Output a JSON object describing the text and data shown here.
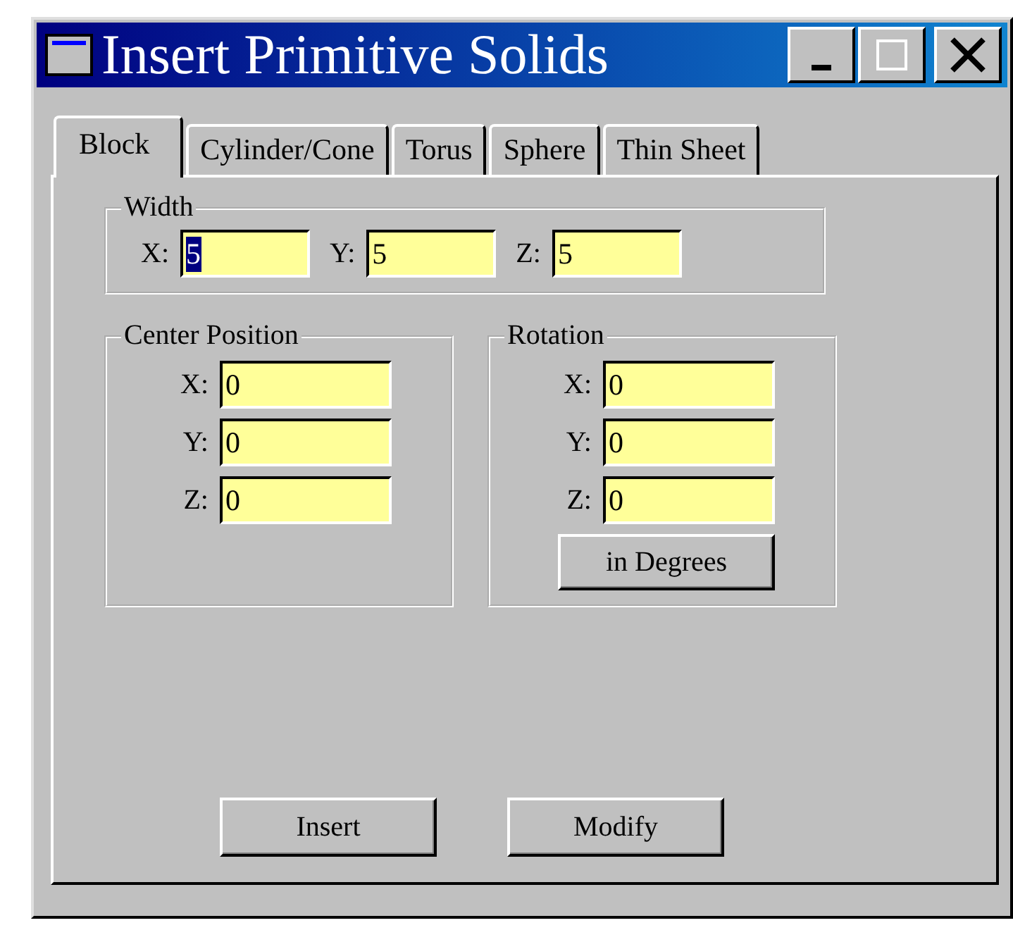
{
  "window": {
    "title": "Insert Primitive Solids"
  },
  "tabs": [
    {
      "label": "Block",
      "selected": true
    },
    {
      "label": "Cylinder/Cone",
      "selected": false
    },
    {
      "label": "Torus",
      "selected": false
    },
    {
      "label": "Sphere",
      "selected": false
    },
    {
      "label": "Thin Sheet",
      "selected": false
    }
  ],
  "width_group": {
    "title": "Width",
    "fields": [
      {
        "label": "X:",
        "value": "5",
        "text_selected": true
      },
      {
        "label": "Y:",
        "value": "5",
        "text_selected": false
      },
      {
        "label": "Z:",
        "value": "5",
        "text_selected": false
      }
    ]
  },
  "center_position": {
    "title": "Center Position",
    "fields": [
      {
        "label": "X:",
        "value": "0",
        "text_selected": false
      },
      {
        "label": "Y:",
        "value": "0",
        "text_selected": false
      },
      {
        "label": "Z:",
        "value": "0",
        "text_selected": false
      }
    ]
  },
  "rotation": {
    "title": "Rotation",
    "fields": [
      {
        "label": "X:",
        "value": "0",
        "text_selected": false
      },
      {
        "label": "Y:",
        "value": "0",
        "text_selected": false
      },
      {
        "label": "Z:",
        "value": "0",
        "text_selected": false
      }
    ],
    "unit_button": "in Degrees"
  },
  "buttons": [
    "Insert",
    "Modify"
  ]
}
